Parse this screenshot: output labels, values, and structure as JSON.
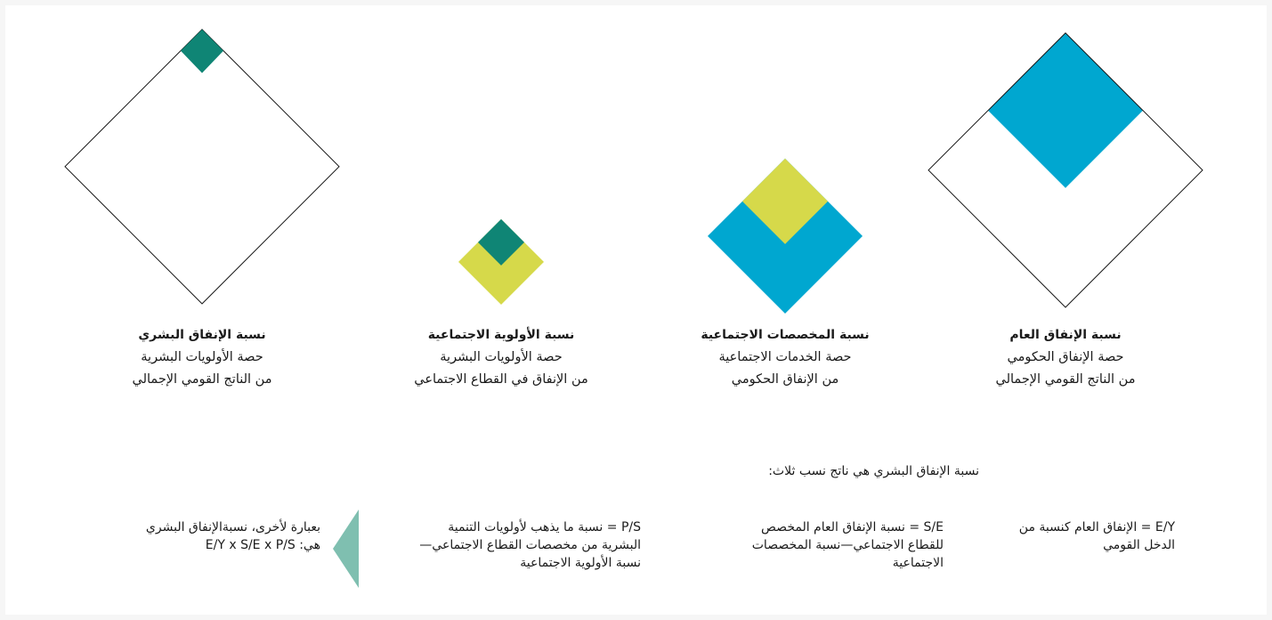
{
  "colors": {
    "outline": "#1a1a1a",
    "blue": "#00a7d0",
    "yellow": "#d6d94a",
    "green": "#0f8575",
    "arrow": "#7fbfb0"
  },
  "captions": [
    {
      "title": "نسبة الإنفاق العام",
      "line1": "حصة  الإنفاق الحكومي",
      "line2": "من الناتج القومي الإجمالي"
    },
    {
      "title": "نسبة المخصصات الاجتماعية",
      "line1": "حصة الخدمات الاجتماعية",
      "line2": "من الإنفاق الحكومي"
    },
    {
      "title": "نسبة الأولوية الاجتماعية",
      "line1": "حصة الأولويات البشرية",
      "line2": "من الإنفاق في القطاع الاجتماعي"
    },
    {
      "title": "نسبة الإنفاق البشري",
      "line1": "حصة الأولويات البشرية",
      "line2": "من الناتج القومي الإجمالي"
    }
  ],
  "intro": "نسبة الإنفاق البشري هي ناتج نسب ثلاث:",
  "items": [
    {
      "code": "E/Y",
      "text": "= الإنفاق العام كنسبة من الدخل القومي"
    },
    {
      "code": "S/E",
      "text": "= نسبة الإنفاق العام المخصص للقطاع الاجتماعي—نسبة المخصصات الاجتماعية"
    },
    {
      "code": "P/S",
      "text": "= نسبة ما يذهب لأولويات التنمية البشرية من مخصصات القطاع الاجتماعي—نسبة الأولوية الاجتماعية"
    }
  ],
  "summary": {
    "text": "بعبارة لأخرى، نسبةالإنفاق البشري هي:",
    "formula": "E/Y x S/E x P/S"
  }
}
